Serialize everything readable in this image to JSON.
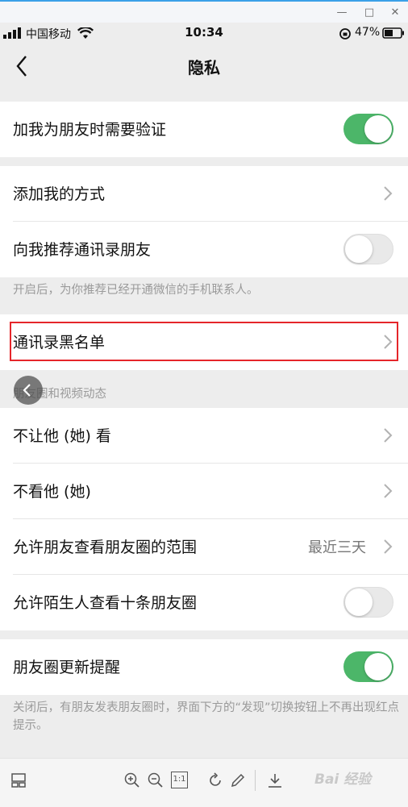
{
  "status_bar": {
    "carrier": "中国移动",
    "time": "10:34",
    "battery": "47%"
  },
  "nav": {
    "title": "隐私"
  },
  "sections": {
    "verify_label": "加我为朋友时需要验证",
    "add_methods_label": "添加我的方式",
    "recommend_contacts_label": "向我推荐通讯录朋友",
    "recommend_note": "开启后，为你推荐已经开通微信的手机联系人。",
    "blacklist_label": "通讯录黑名单",
    "moments_header": "朋友圈和视频动态",
    "dont_let_see_label": "不让他 (她) 看",
    "dont_see_label": "不看他 (她)",
    "range_label": "允许朋友查看朋友圈的范围",
    "range_value": "最近三天",
    "strangers_label": "允许陌生人查看十条朋友圈",
    "update_reminder_label": "朋友圈更新提醒",
    "update_note": "关闭后，有朋友发表朋友圈时，界面下方的“发现”切换按钮上不再出现红点提示。"
  },
  "toggles": {
    "verify": "on",
    "recommend_contacts": "off",
    "strangers": "off",
    "update_reminder": "on"
  },
  "toolbar": {
    "fit_label": "1:1"
  },
  "watermark": "Bai 经验",
  "colors": {
    "accent_green": "#4cb669",
    "highlight_red": "#e5262a"
  }
}
